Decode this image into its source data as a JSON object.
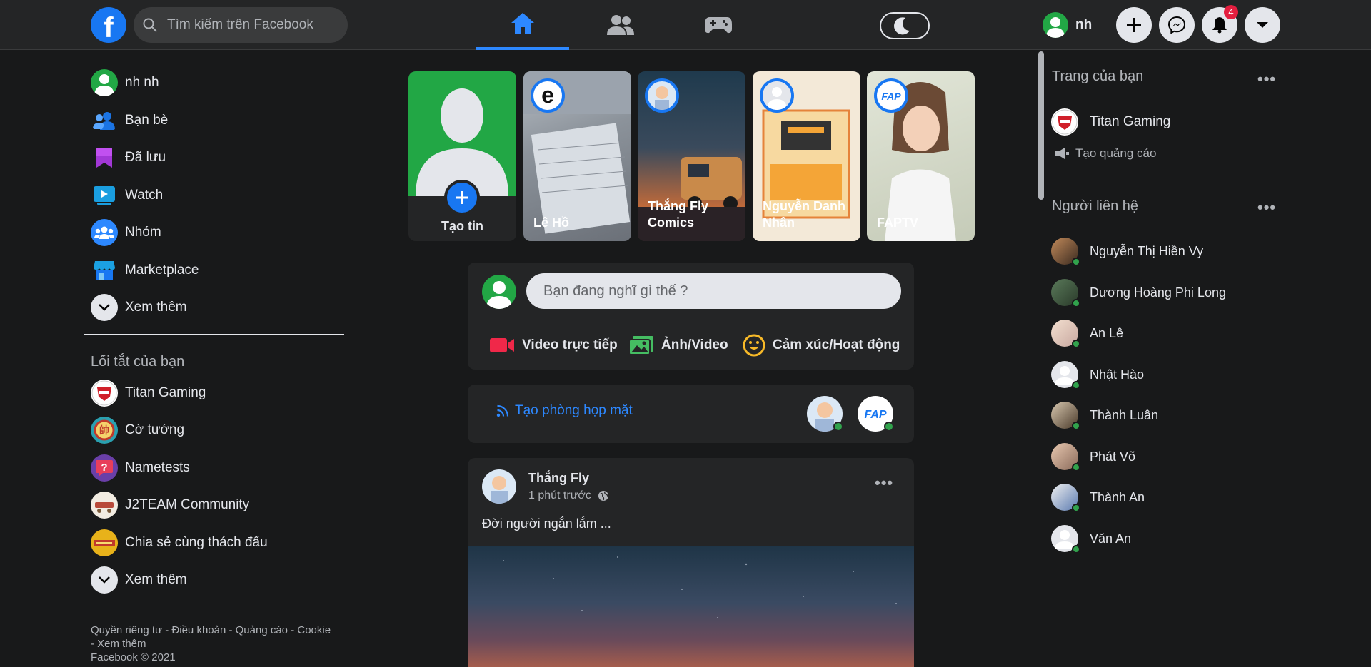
{
  "topbar": {
    "search_placeholder": "Tìm kiếm trên Facebook",
    "profile_name": "nh",
    "notification_count": "4"
  },
  "left": {
    "menu": [
      {
        "label": "nh nh",
        "icon": "profile-avatar"
      },
      {
        "label": "Bạn bè",
        "icon": "friends-icon"
      },
      {
        "label": "Đã lưu",
        "icon": "bookmark-icon"
      },
      {
        "label": "Watch",
        "icon": "watch-icon"
      },
      {
        "label": "Nhóm",
        "icon": "groups-icon"
      },
      {
        "label": "Marketplace",
        "icon": "marketplace-icon"
      },
      {
        "label": "Xem thêm",
        "icon": "chevron-down-icon"
      }
    ],
    "shortcuts_title": "Lối tắt của bạn",
    "shortcuts": [
      {
        "label": "Titan Gaming"
      },
      {
        "label": "Cờ tướng"
      },
      {
        "label": "Nametests"
      },
      {
        "label": "J2TEAM Community"
      },
      {
        "label": "Chia sẻ cùng thách đấu"
      },
      {
        "label": "Xem thêm"
      }
    ],
    "footer_line1": "Quyền riêng tư - Điều khoản - Quảng cáo - Cookie",
    "footer_line2": "- Xem thêm",
    "footer_line3": "Facebook © 2021"
  },
  "stories": [
    {
      "name": "Tạo tin"
    },
    {
      "name": "Lê Hồ"
    },
    {
      "name": "Thắng Fly Comics"
    },
    {
      "name": "Nguyễn Danh Nhân"
    },
    {
      "name": "FAPTV"
    }
  ],
  "composer": {
    "placeholder": "Bạn đang nghĩ gì thế ?",
    "actions": [
      "Video trực tiếp",
      "Ảnh/Video",
      "Cảm xúc/Hoạt động"
    ]
  },
  "room": {
    "label": "Tạo phòng họp mặt"
  },
  "post": {
    "author": "Thắng Fly",
    "time": "1 phút trước",
    "text": "Đời người ngắn lắm ..."
  },
  "right": {
    "pages_title": "Trang của bạn",
    "page_name": "Titan Gaming",
    "create_ad": "Tạo quảng cáo",
    "contacts_title": "Người liên hệ",
    "contacts": [
      {
        "name": "Nguyễn Thị Hiền Vy"
      },
      {
        "name": "Dương Hoàng Phi Long"
      },
      {
        "name": "An Lê"
      },
      {
        "name": "Nhật Hào"
      },
      {
        "name": "Thành Luân"
      },
      {
        "name": "Phát Võ"
      },
      {
        "name": "Thành An"
      },
      {
        "name": "Văn An"
      }
    ]
  },
  "colors": {
    "accent": "#1877f2",
    "background": "#18191a",
    "surface": "#242526",
    "online": "#31a24c",
    "badge": "#e41e3f"
  }
}
